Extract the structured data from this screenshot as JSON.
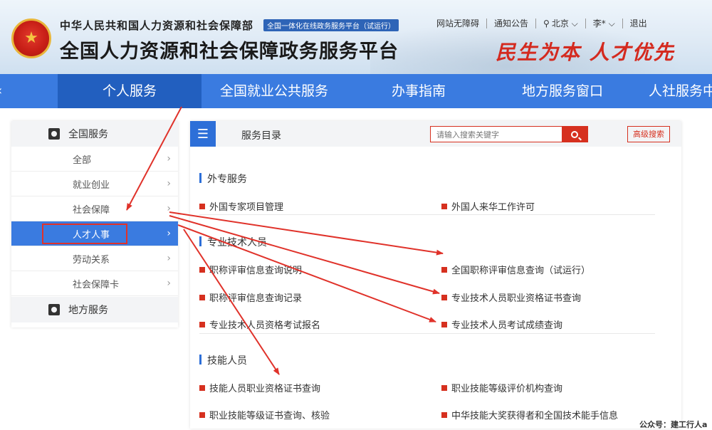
{
  "header": {
    "org_name": "中华人民共和国人力资源和社会保障部",
    "tagline": "全国一体化在线政务服务平台（试运行）",
    "site_title": "全国人力资源和社会保障政务服务平台",
    "links": {
      "accessibility": "网站无障碍",
      "notice": "通知公告",
      "location": "北京 ⌵",
      "user": "李* ⌵",
      "logout": "退出"
    },
    "slogan": "民生为本 人才优先"
  },
  "nav": {
    "items": [
      "个人服务",
      "全国就业公共服务",
      "办事指南",
      "地方服务窗口",
      "人社服务中心"
    ]
  },
  "sidebar": {
    "national_label": "全国服务",
    "items": [
      "全部",
      "就业创业",
      "社会保障",
      "人才人事",
      "劳动关系",
      "社会保障卡"
    ],
    "local_label": "地方服务"
  },
  "panel": {
    "title": "服务目录",
    "search_placeholder": "请输入搜索关键字",
    "advanced_search": "高级搜索",
    "sections": [
      {
        "title": "外专服务",
        "services": [
          "外国专家项目管理",
          "外国人来华工作许可"
        ]
      },
      {
        "title": "专业技术人员",
        "services": [
          "职称评审信息查询说明",
          "全国职称评审信息查询（试运行）",
          "职称评审信息查询记录",
          "专业技术人员职业资格证书查询",
          "专业技术人员资格考试报名",
          "专业技术人员考试成绩查询"
        ]
      },
      {
        "title": "技能人员",
        "services": [
          "技能人员职业资格证书查询",
          "职业技能等级评价机构查询",
          "职业技能等级证书查询、核验",
          "中华技能大奖获得者和全国技术能手信息"
        ]
      }
    ]
  },
  "watermark": "公众号：建工行人a",
  "colors": {
    "nav_blue": "#3a7be0",
    "nav_active": "#225fbf",
    "accent_red": "#d6301f",
    "annotation_red": "#e0322a"
  }
}
